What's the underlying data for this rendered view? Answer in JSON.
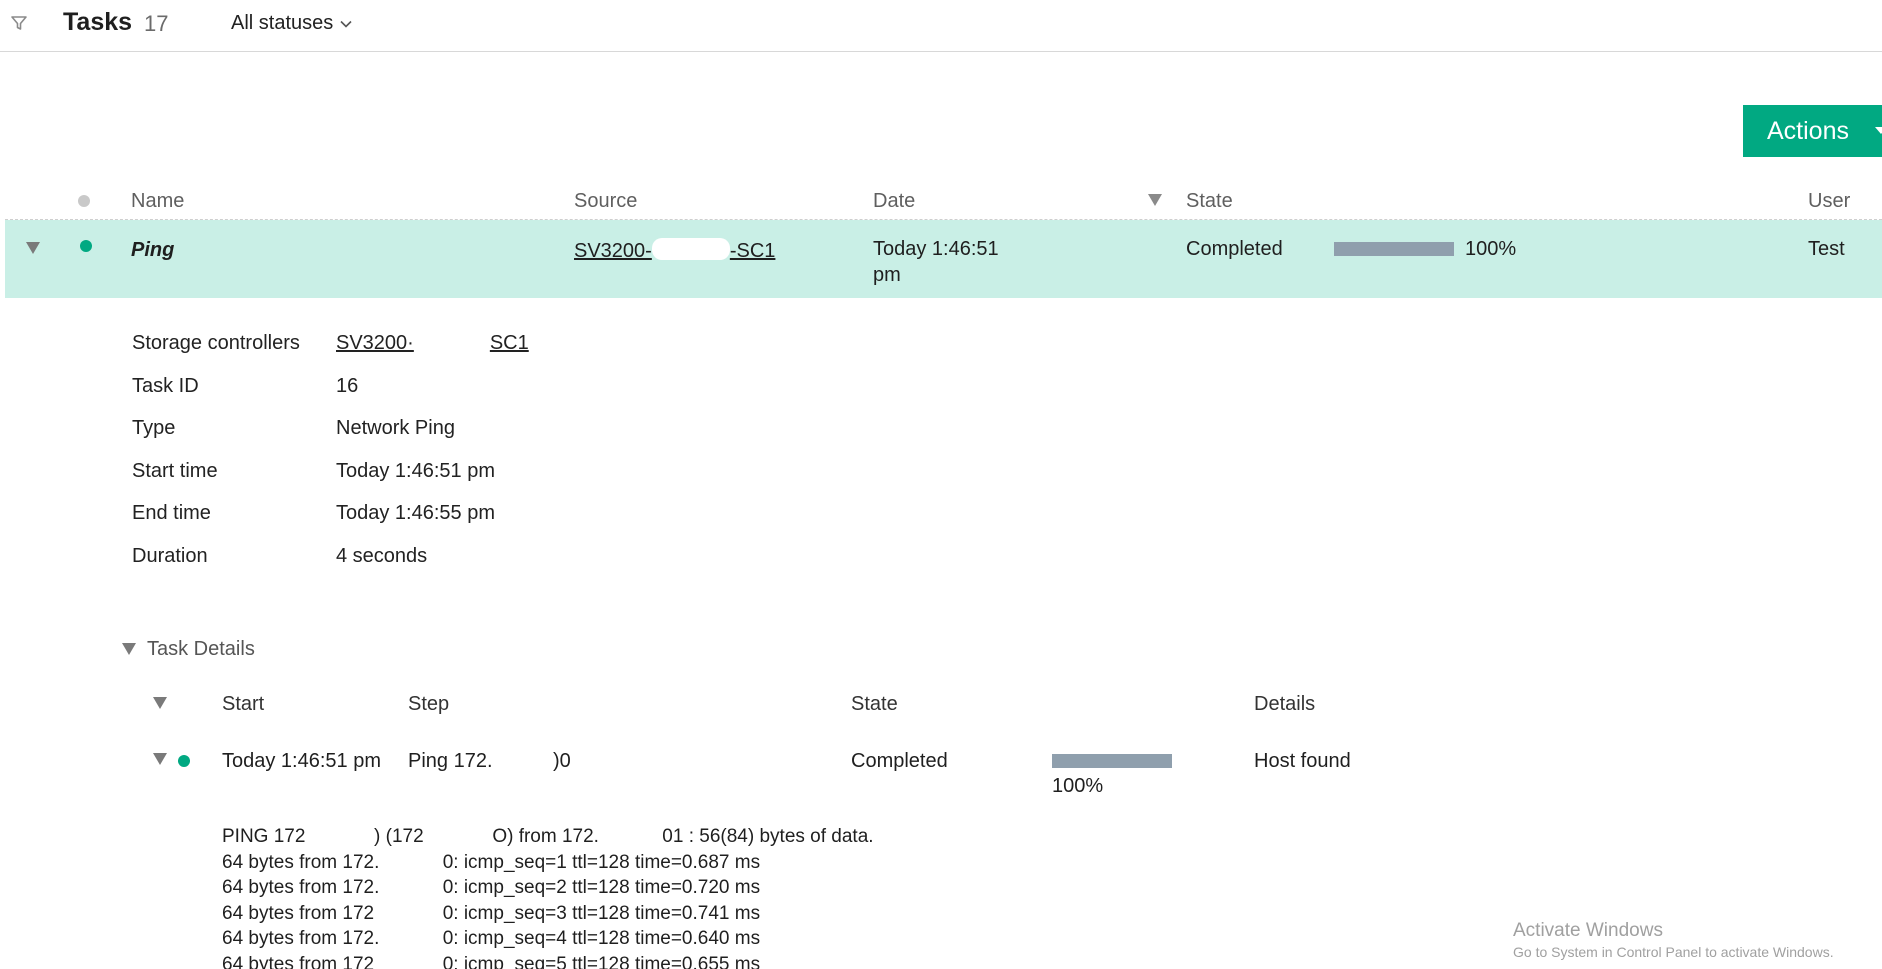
{
  "topbar": {
    "filter_icon": "filter-icon",
    "title": "Tasks",
    "count": "17",
    "status_filter": "All statuses"
  },
  "actions": {
    "label": "Actions"
  },
  "table": {
    "headers": {
      "name": "Name",
      "source": "Source",
      "date": "Date",
      "state": "State",
      "user": "User"
    },
    "row": {
      "name": "Ping",
      "source": "SV3200-",
      "source_suffix": "-SC1",
      "date_line1": "Today 1:46:51",
      "date_line2": "pm",
      "state": "Completed",
      "progress": 100,
      "progress_label": "100%",
      "user": "Test"
    }
  },
  "details": {
    "storage_controllers_label": "Storage controllers",
    "storage_controllers_value": "SV3200·",
    "storage_controllers_suffix": "SC1",
    "task_id_label": "Task ID",
    "task_id_value": "16",
    "type_label": "Type",
    "type_value": "Network Ping",
    "start_label": "Start time",
    "start_value": "Today 1:46:51 pm",
    "end_label": "End time",
    "end_value": "Today 1:46:55 pm",
    "duration_label": "Duration",
    "duration_value": "4 seconds"
  },
  "task_details": {
    "title": "Task Details",
    "headers": {
      "start": "Start",
      "step": "Step",
      "state": "State",
      "details": "Details"
    },
    "row": {
      "start": "Today 1:46:51 pm",
      "step": "Ping 172.",
      "step_suffix": ")0",
      "state": "Completed",
      "progress": 100,
      "progress_label": "100%",
      "details": "Host found"
    },
    "log": [
      "PING 172             ) (172             O) from 172.            01 : 56(84) bytes of data.",
      "64 bytes from 172.            0: icmp_seq=1 ttl=128 time=0.687 ms",
      "64 bytes from 172.            0: icmp_seq=2 ttl=128 time=0.720 ms",
      "64 bytes from 172             0: icmp_seq=3 ttl=128 time=0.741 ms",
      "64 bytes from 172.            0: icmp_seq=4 ttl=128 time=0.640 ms",
      "64 bytes from 172             0: icmp_seq=5 ttl=128 time=0.655 ms"
    ]
  },
  "watermark": {
    "line1": "Activate Windows",
    "line2": "Go to System in Control Panel to activate Windows."
  },
  "colors": {
    "accent": "#01a982",
    "row_highlight": "#c9efe6",
    "progress_fill": "#8f9fad"
  }
}
